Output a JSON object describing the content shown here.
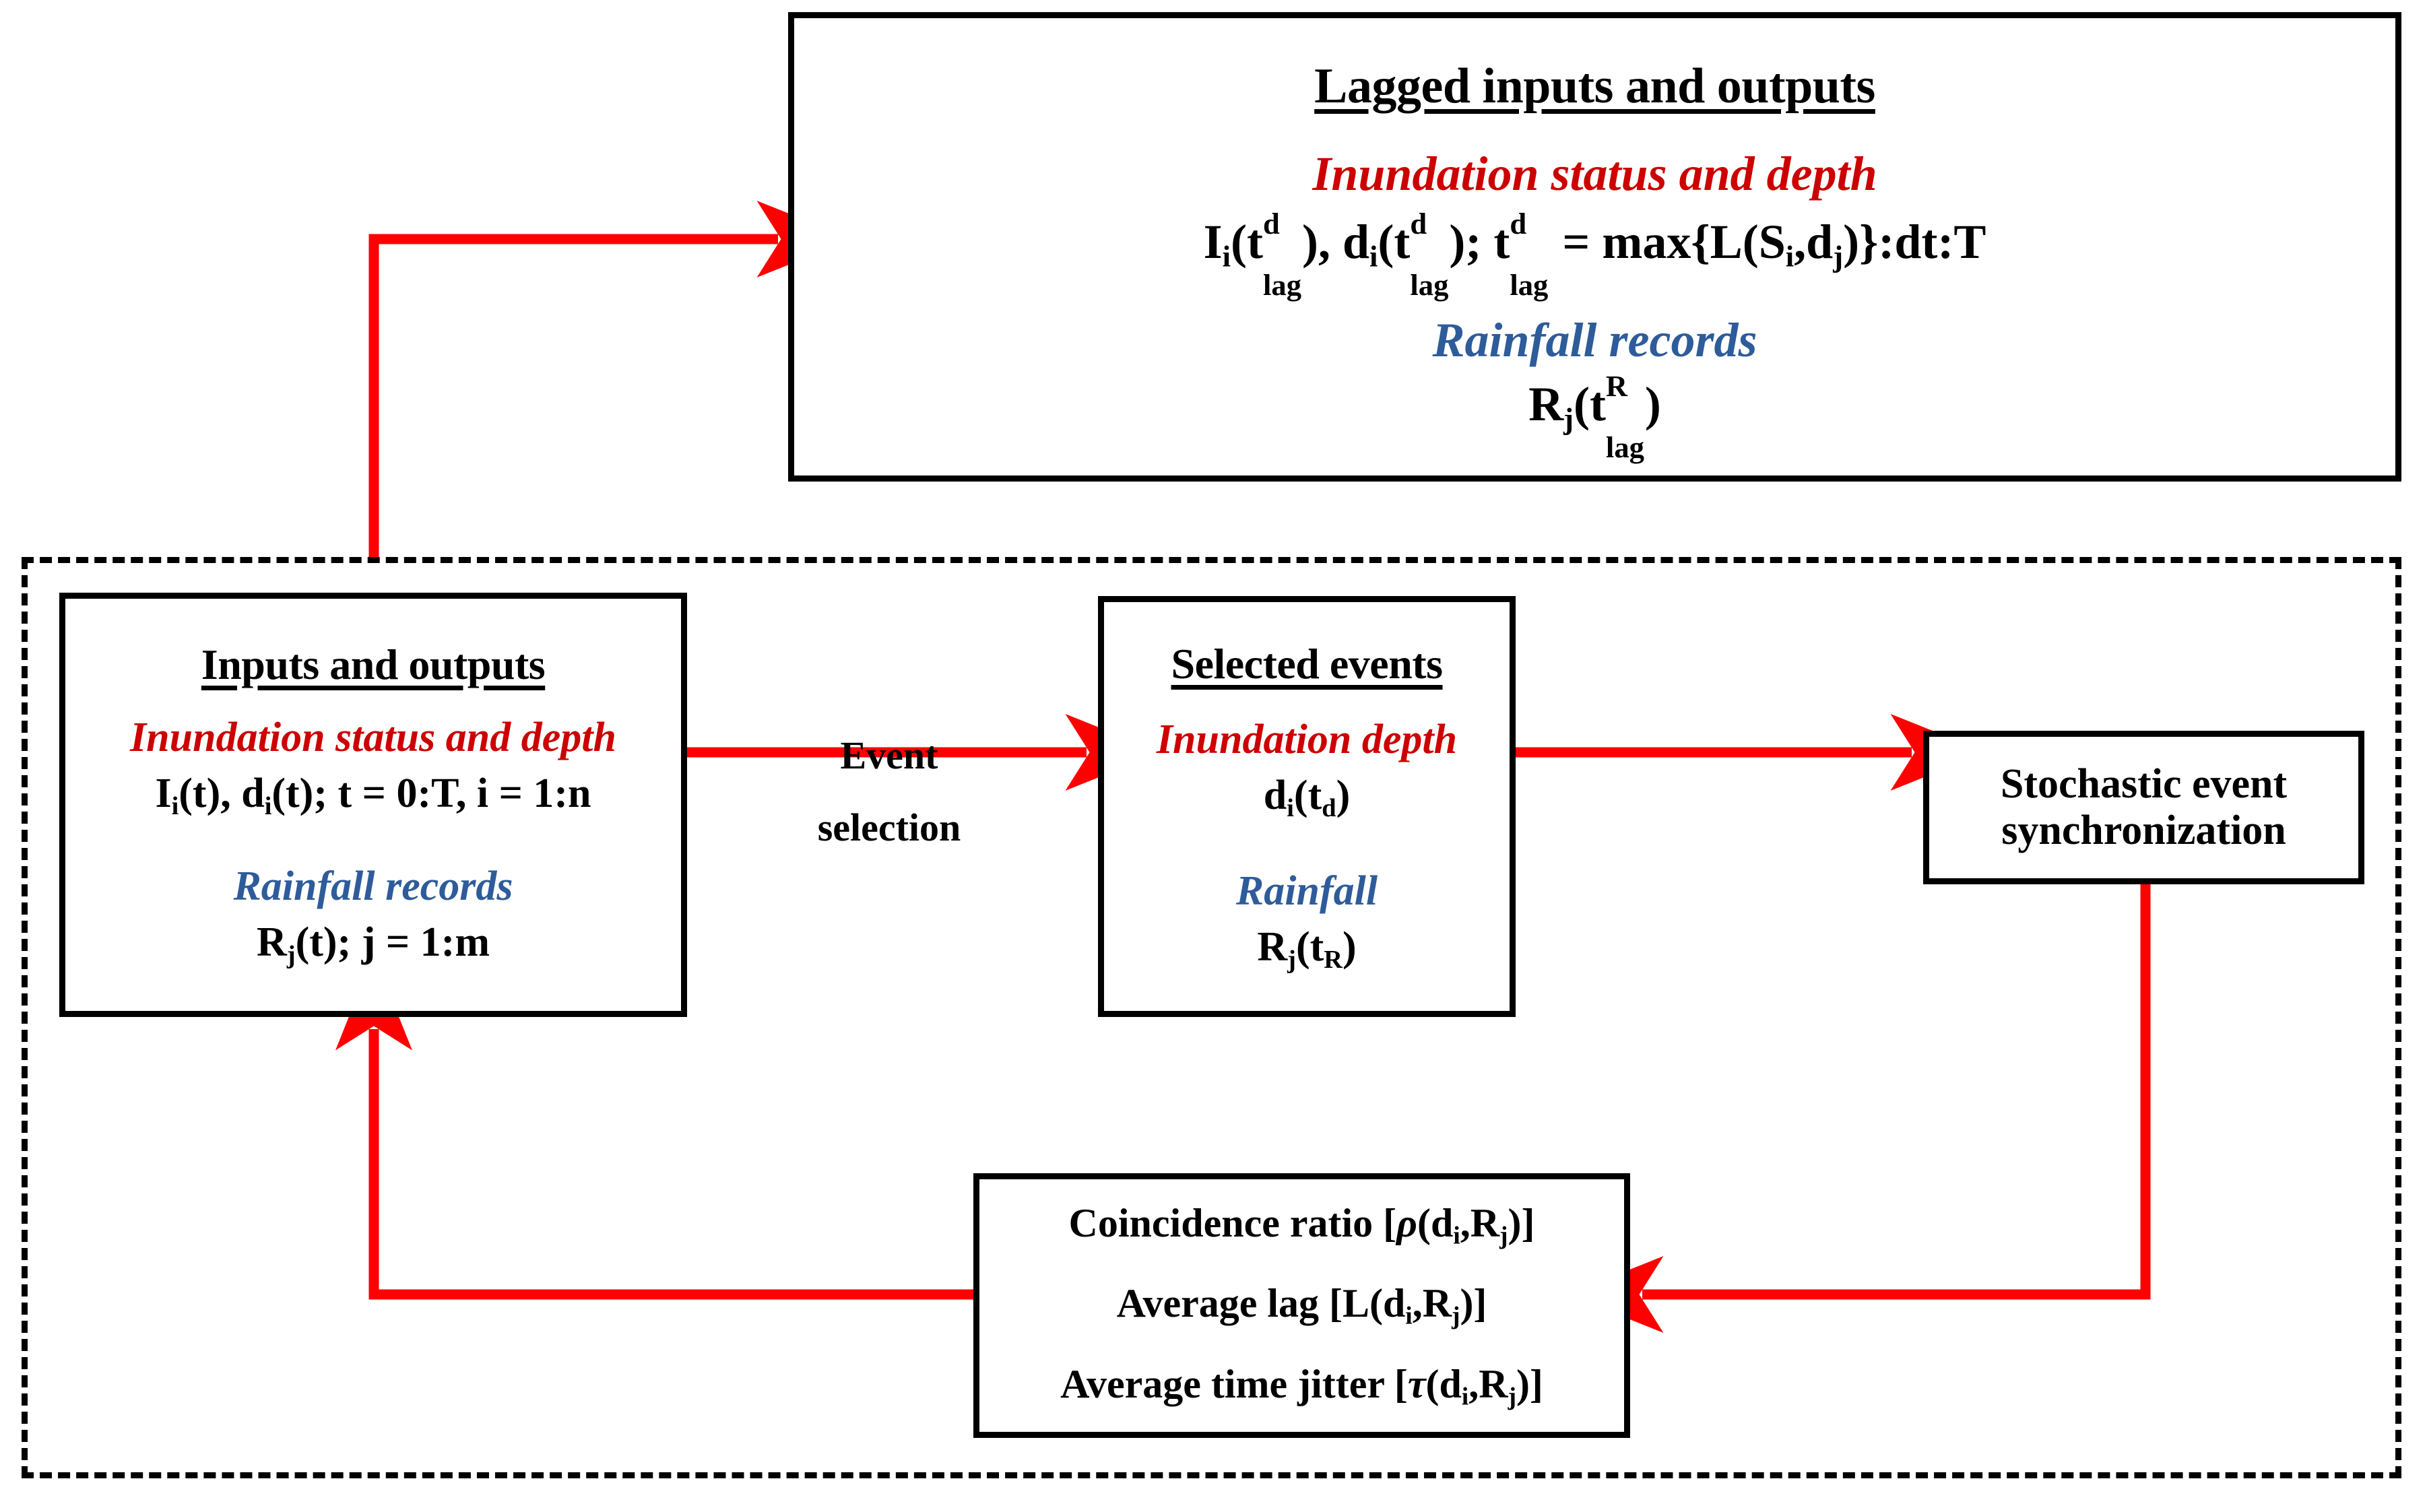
{
  "colors": {
    "red": "#CC0000",
    "arrow_red": "#FF0000",
    "blue": "#2E5C9A",
    "black": "#000000"
  },
  "top_box": {
    "heading": "Lagged inputs and outputs",
    "red_subtitle": "Inundation status and depth",
    "formula_main": "I_i(t_lag^d), d_i(t_lag^d); t_lag^d = max{L(S_i,d_j)}:dt:T",
    "blue_subtitle": "Rainfall records",
    "formula_rain": "R_j(t_lag^R)"
  },
  "inputs_box": {
    "heading": "Inputs and outputs",
    "red_subtitle": "Inundation status and depth",
    "formula_main": "I_i(t), d_i(t); t = 0:T, i = 1:n",
    "blue_subtitle": "Rainfall records",
    "formula_rain": "R_j(t); j = 1:m"
  },
  "selected_box": {
    "heading": "Selected events",
    "red_subtitle": "Inundation depth",
    "formula_depth": "d_i(t_d)",
    "blue_subtitle": "Rainfall",
    "formula_rain": "R_j(t_R)"
  },
  "stochastic_box": {
    "line1": "Stochastic event",
    "line2": "synchronization"
  },
  "metrics_box": {
    "line1": "Coincidence ratio [ρ(d_i,R_j)]",
    "line2": "Average lag [L(d_i,R_j)]",
    "line3": "Average time jitter [τ(d_i,R_j)]"
  },
  "edge_labels": {
    "event_selection_line1": "Event",
    "event_selection_line2": "selection"
  },
  "chart_data": {
    "type": "table",
    "title": "Stochastic event synchronization flowchart",
    "nodes": [
      {
        "id": "lagged",
        "label": "Lagged inputs and outputs",
        "region": "outer"
      },
      {
        "id": "inputs",
        "label": "Inputs and outputs",
        "region": "dashed-loop"
      },
      {
        "id": "selected",
        "label": "Selected events",
        "region": "dashed-loop"
      },
      {
        "id": "sync",
        "label": "Stochastic event synchronization",
        "region": "dashed-loop"
      },
      {
        "id": "metrics",
        "label": "Coincidence ratio / Average lag / Average time jitter",
        "region": "dashed-loop"
      }
    ],
    "edges": [
      {
        "from": "inputs",
        "to": "selected",
        "label": "Event selection",
        "color": "#FF0000"
      },
      {
        "from": "selected",
        "to": "sync",
        "label": "",
        "color": "#FF0000"
      },
      {
        "from": "sync",
        "to": "metrics",
        "label": "",
        "color": "#FF0000"
      },
      {
        "from": "metrics",
        "to": "inputs",
        "label": "",
        "color": "#FF0000"
      },
      {
        "from": "dashed-loop",
        "to": "lagged",
        "label": "",
        "color": "#FF0000"
      }
    ]
  }
}
